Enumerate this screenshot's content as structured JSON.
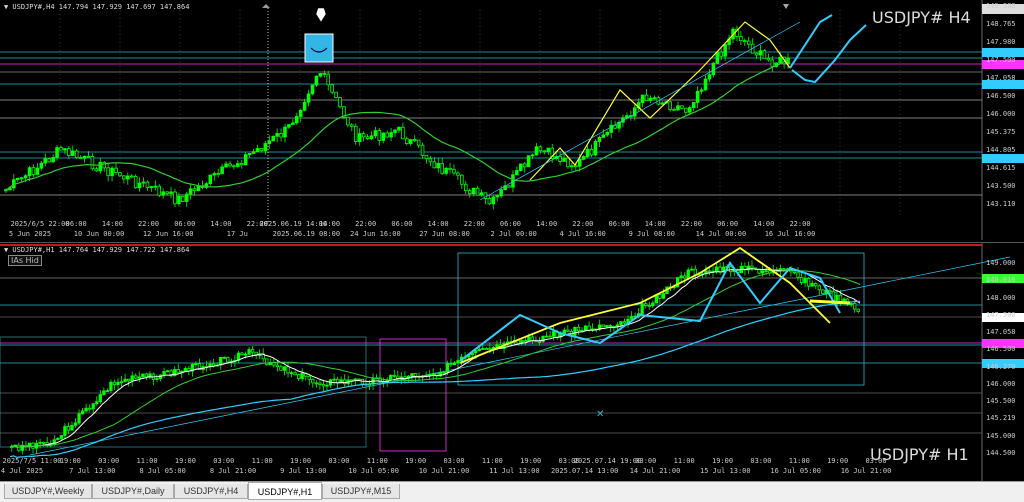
{
  "h4": {
    "header": "▼ USDJPY#,H4  147.794 147.929 147.697 147.864",
    "symbol_big": "USDJPY#  H4",
    "price_ticks": [
      "149.388",
      "148.765",
      "147.980",
      "147.500",
      "147.058",
      "146.500",
      "146.000",
      "145.375",
      "144.805",
      "144.615",
      "143.500",
      "143.110"
    ],
    "time_labels": [
      "5 Jun 2025",
      "10 Jun 00:00",
      "12 Jun 16:00",
      "17 Ju",
      "2025.06.19 08:00",
      "24 Jun 16:00",
      "27 Jun 08:00",
      "2 Jul 00:00",
      "4 Jul 16:00",
      "9 Jul 08:00",
      "14 Jul 00:00",
      "16 Jul 16:00"
    ],
    "top_time_labels": [
      "2025/6/5 22:00",
      "06:00",
      "14:00",
      "22:00",
      "06:00",
      "14:00",
      "22:00",
      "2025.06.19 14:00",
      "14:00",
      "22:00",
      "06:00",
      "14:00",
      "22:00",
      "06:00",
      "14:00",
      "22:00",
      "06:00",
      "14:00",
      "22:00",
      "06:00",
      "14:00",
      "22:00"
    ]
  },
  "h1": {
    "header": "▼ USDJPY#,H1  147.764 147.929 147.722 147.864",
    "ias_label": "IAs Hid",
    "symbol_big": "USDJPY#  H1",
    "price_ticks": [
      "149.000",
      "148.616",
      "148.000",
      "147.500",
      "147.058",
      "146.500",
      "146.270",
      "146.000",
      "145.500",
      "145.219",
      "145.000",
      "144.500"
    ],
    "time_labels": [
      "4 Jul 2025",
      "7 Jul 13:00",
      "8 Jul 05:00",
      "8 Jul 21:00",
      "9 Jul 13:00",
      "10 Jul 05:00",
      "10 Jul 21:00",
      "11 Jul 13:00",
      "2025.07.14 13:00",
      "14 Jul 21:00",
      "15 Jul 13:00",
      "16 Jul 05:00",
      "16 Jul 21:00"
    ],
    "top_time_labels": [
      "2025/7/5 11:00",
      "19:00",
      "03:00",
      "11:00",
      "19:00",
      "03:00",
      "11:00",
      "19:00",
      "03:00",
      "11:00",
      "19:00",
      "03:00",
      "11:00",
      "19:00",
      "03:00",
      "2025.07.14 19:00",
      "03:00",
      "11:00",
      "19:00",
      "03:00",
      "11:00",
      "19:00",
      "03:00"
    ]
  },
  "tabs": [
    "USDJPY#,Weekly",
    "USDJPY#,Daily",
    "USDJPY#,H4",
    "USDJPY#,H1",
    "USDJPY#,M15"
  ],
  "active_tab": "USDJPY#,H1",
  "colors": {
    "bull": "#00ff00",
    "bear": "#00ff00",
    "ma_green": "#33cc33",
    "ma_yellow": "#ffff33",
    "ma_cyan": "#33ccff",
    "hline_cyan": "#2fb8c8",
    "hline_magenta": "#ff33ff",
    "red": "#ff2222"
  }
}
